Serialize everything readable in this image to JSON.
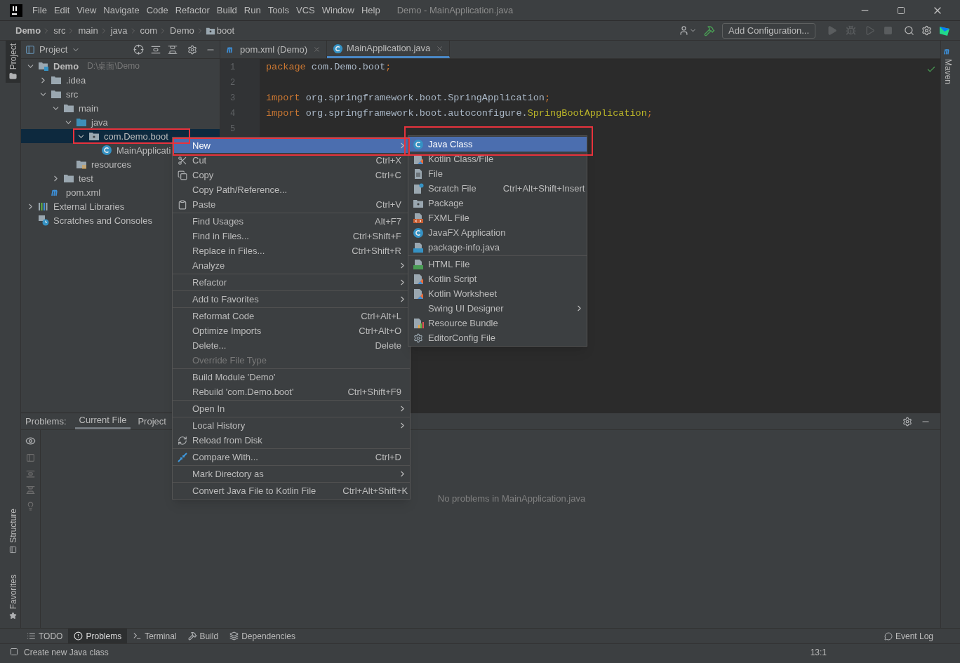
{
  "window_title": "Demo - MainApplication.java",
  "menu_bar": [
    "File",
    "Edit",
    "View",
    "Navigate",
    "Code",
    "Refactor",
    "Build",
    "Run",
    "Tools",
    "VCS",
    "Window",
    "Help"
  ],
  "breadcrumbs": [
    {
      "label": "Demo",
      "bold": true
    },
    {
      "label": "src",
      "bold": false
    },
    {
      "label": "main",
      "bold": false
    },
    {
      "label": "java",
      "bold": false
    },
    {
      "label": "com",
      "bold": false
    },
    {
      "label": "Demo",
      "bold": false
    },
    {
      "label": "boot",
      "bold": false
    }
  ],
  "run_config": "Add Configuration...",
  "left_stripe": [
    {
      "label": "Project",
      "selected": true
    },
    {
      "label": "Structure",
      "selected": false
    },
    {
      "label": "Favorites",
      "selected": false
    }
  ],
  "right_stripe": {
    "label": "Maven"
  },
  "project_panel": {
    "title": "Project",
    "tree": [
      {
        "label": "Demo",
        "detail": "D:\\桌面\\Demo",
        "kind": "module",
        "expanded": true,
        "selected": false,
        "children": [
          {
            "label": ".idea",
            "kind": "folder",
            "expanded": false,
            "selected": false
          },
          {
            "label": "src",
            "kind": "folder",
            "expanded": true,
            "selected": false,
            "children": [
              {
                "label": "main",
                "kind": "folder",
                "expanded": true,
                "selected": false,
                "children": [
                  {
                    "label": "java",
                    "kind": "source",
                    "expanded": true,
                    "selected": false,
                    "children": [
                      {
                        "label": "com.Demo.boot",
                        "kind": "package",
                        "expanded": true,
                        "selected": true,
                        "children": [
                          {
                            "label": "MainApplicati",
                            "kind": "class",
                            "selected": false
                          }
                        ]
                      }
                    ]
                  },
                  {
                    "label": "resources",
                    "kind": "resources",
                    "selected": false
                  }
                ]
              },
              {
                "label": "test",
                "kind": "folder",
                "expanded": false,
                "selected": false
              }
            ]
          },
          {
            "label": "pom.xml",
            "kind": "maven",
            "selected": false
          }
        ]
      },
      {
        "label": "External Libraries",
        "kind": "libraries",
        "expanded": false,
        "selected": false
      },
      {
        "label": "Scratches and Consoles",
        "kind": "scratches",
        "selected": false
      }
    ]
  },
  "editor_tabs": [
    {
      "label": "pom.xml (Demo)",
      "kind": "maven",
      "selected": false
    },
    {
      "label": "MainApplication.java",
      "kind": "class",
      "selected": true
    }
  ],
  "editor": {
    "lines": [
      {
        "number": "1",
        "tokens": [
          {
            "text": "package",
            "kind": "keyword"
          },
          {
            "text": " com.Demo.boot",
            "kind": "plain"
          },
          {
            "text": ";",
            "kind": "keyword"
          }
        ]
      },
      {
        "number": "2"
      },
      {
        "number": "3",
        "tokens": [
          {
            "text": "import",
            "kind": "keyword"
          },
          {
            "text": " org.springframework.boot.SpringApplication",
            "kind": "plain"
          },
          {
            "text": ";",
            "kind": "keyword"
          }
        ]
      },
      {
        "number": "4",
        "tokens": [
          {
            "text": "import",
            "kind": "keyword"
          },
          {
            "text": " org.springframework.boot.autoconfigure.",
            "kind": "plain"
          },
          {
            "text": "SpringBootApplication",
            "kind": "annotation"
          },
          {
            "text": ";",
            "kind": "keyword"
          }
        ]
      },
      {
        "number": "5"
      }
    ]
  },
  "context_menu": [
    {
      "kind": "submenu",
      "label": "New",
      "selected": true,
      "disabled": false
    },
    {
      "kind": "cut",
      "label": "Cut",
      "shortcut": "Ctrl+X",
      "selected": false,
      "disabled": false
    },
    {
      "kind": "copy",
      "label": "Copy",
      "shortcut": "Ctrl+C",
      "selected": false,
      "disabled": false
    },
    {
      "kind": "plain",
      "label": "Copy Path/Reference...",
      "selected": false,
      "disabled": false
    },
    {
      "kind": "paste",
      "label": "Paste",
      "shortcut": "Ctrl+V",
      "selected": false,
      "disabled": false
    },
    {
      "kind": "separator"
    },
    {
      "kind": "plain",
      "label": "Find Usages",
      "shortcut": "Alt+F7",
      "selected": false,
      "disabled": false
    },
    {
      "kind": "plain",
      "label": "Find in Files...",
      "shortcut": "Ctrl+Shift+F",
      "selected": false,
      "disabled": false
    },
    {
      "kind": "plain",
      "label": "Replace in Files...",
      "shortcut": "Ctrl+Shift+R",
      "selected": false,
      "disabled": false
    },
    {
      "kind": "submenu",
      "label": "Analyze",
      "selected": false,
      "disabled": false
    },
    {
      "kind": "separator"
    },
    {
      "kind": "submenu",
      "label": "Refactor",
      "selected": false,
      "disabled": false
    },
    {
      "kind": "separator"
    },
    {
      "kind": "submenu",
      "label": "Add to Favorites",
      "selected": false,
      "disabled": false
    },
    {
      "kind": "separator"
    },
    {
      "kind": "plain",
      "label": "Reformat Code",
      "shortcut": "Ctrl+Alt+L",
      "selected": false,
      "disabled": false
    },
    {
      "kind": "plain",
      "label": "Optimize Imports",
      "shortcut": "Ctrl+Alt+O",
      "selected": false,
      "disabled": false
    },
    {
      "kind": "plain",
      "label": "Delete...",
      "shortcut": "Delete",
      "selected": false,
      "disabled": false
    },
    {
      "kind": "plain",
      "label": "Override File Type",
      "selected": false,
      "disabled": true
    },
    {
      "kind": "separator"
    },
    {
      "kind": "plain",
      "label": "Build Module 'Demo'",
      "selected": false,
      "disabled": false
    },
    {
      "kind": "plain",
      "label": "Rebuild 'com.Demo.boot'",
      "shortcut": "Ctrl+Shift+F9",
      "selected": false,
      "disabled": false
    },
    {
      "kind": "separator"
    },
    {
      "kind": "submenu",
      "label": "Open In",
      "selected": false,
      "disabled": false
    },
    {
      "kind": "separator"
    },
    {
      "kind": "submenu",
      "label": "Local History",
      "selected": false,
      "disabled": false
    },
    {
      "kind": "reload",
      "label": "Reload from Disk",
      "selected": false,
      "disabled": false
    },
    {
      "kind": "separator"
    },
    {
      "kind": "compare",
      "label": "Compare With...",
      "shortcut": "Ctrl+D",
      "selected": false,
      "disabled": false
    },
    {
      "kind": "separator"
    },
    {
      "kind": "submenu",
      "label": "Mark Directory as",
      "selected": false,
      "disabled": false
    },
    {
      "kind": "separator"
    },
    {
      "kind": "plain",
      "label": "Convert Java File to Kotlin File",
      "shortcut": "Ctrl+Alt+Shift+K",
      "selected": false,
      "disabled": false
    }
  ],
  "new_submenu": [
    {
      "kind": "class",
      "label": "Java Class",
      "selected": true
    },
    {
      "kind": "kotlin",
      "label": "Kotlin Class/File",
      "selected": false
    },
    {
      "kind": "file",
      "label": "File",
      "selected": false
    },
    {
      "kind": "scratch",
      "label": "Scratch File",
      "shortcut": "Ctrl+Alt+Shift+Insert",
      "selected": false
    },
    {
      "kind": "package",
      "label": "Package",
      "selected": false
    },
    {
      "kind": "fxml",
      "label": "FXML File",
      "selected": false
    },
    {
      "kind": "class",
      "label": "JavaFX Application",
      "selected": false
    },
    {
      "kind": "javafile",
      "label": "package-info.java",
      "selected": false
    },
    {
      "kind": "separator"
    },
    {
      "kind": "html",
      "label": "HTML File",
      "selected": false
    },
    {
      "kind": "kotlin",
      "label": "Kotlin Script",
      "selected": false
    },
    {
      "kind": "kotlin",
      "label": "Kotlin Worksheet",
      "selected": false
    },
    {
      "kind": "submenu",
      "label": "Swing UI Designer",
      "selected": false
    },
    {
      "kind": "bundle",
      "label": "Resource Bundle",
      "selected": false
    },
    {
      "kind": "gear",
      "label": "EditorConfig File",
      "selected": false
    }
  ],
  "problems_panel": {
    "label": "Problems:",
    "tabs": [
      {
        "label": "Current File",
        "selected": true
      },
      {
        "label": "Project",
        "selected": false
      }
    ],
    "message": "No problems in MainApplication.java"
  },
  "tool_windows": [
    {
      "label": "TODO",
      "kind": "list",
      "selected": false
    },
    {
      "label": "Problems",
      "kind": "alert",
      "selected": true
    },
    {
      "label": "Terminal",
      "kind": "terminal",
      "selected": false
    },
    {
      "label": "Build",
      "kind": "hammer",
      "selected": false
    },
    {
      "label": "Dependencies",
      "kind": "layers",
      "selected": false
    }
  ],
  "event_log": "Event Log",
  "status_bar": {
    "message": "Create new Java class",
    "position": "13:1"
  }
}
